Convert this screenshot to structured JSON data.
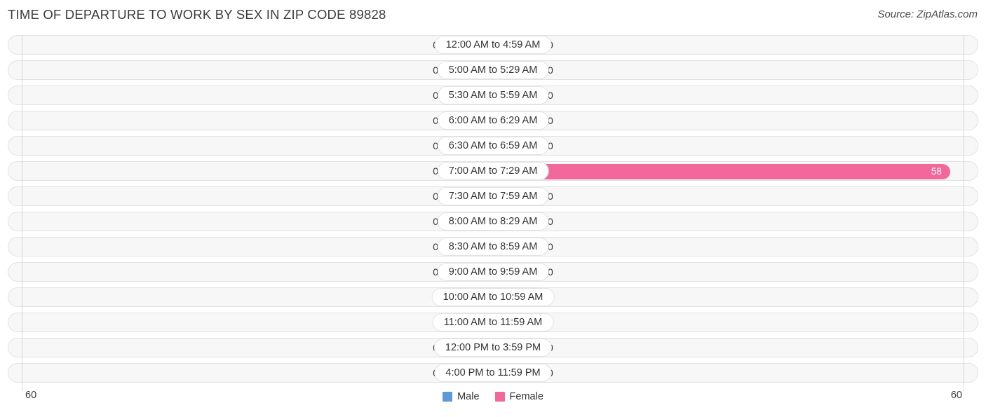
{
  "header": {
    "title": "TIME OF DEPARTURE TO WORK BY SEX IN ZIP CODE 89828",
    "source": "Source: ZipAtlas.com"
  },
  "axis": {
    "left_label": "60",
    "right_label": "60"
  },
  "legend": {
    "items": [
      {
        "label": "Male",
        "color": "#5b9bd5"
      },
      {
        "label": "Female",
        "color": "#f2689a"
      }
    ]
  },
  "colors": {
    "male_bar": "#a5c8ea",
    "female_bar": "#f7a8c4",
    "female_bar_highlight": "#f2689a",
    "row_background": "#f7f7f7",
    "row_border": "#e2e2e2",
    "gridline": "#d6d6d6",
    "title_text": "#3c3c3c"
  },
  "chart_data": {
    "type": "bar",
    "title": "TIME OF DEPARTURE TO WORK BY SEX IN ZIP CODE 89828",
    "subtitle": "Source: ZipAtlas.com",
    "orientation": "horizontal-diverging",
    "xlabel": "",
    "ylabel": "",
    "xlim": [
      60,
      0,
      60
    ],
    "axis_max": 60,
    "grid": true,
    "legend_position": "bottom-center",
    "categories": [
      "12:00 AM to 4:59 AM",
      "5:00 AM to 5:29 AM",
      "5:30 AM to 5:59 AM",
      "6:00 AM to 6:29 AM",
      "6:30 AM to 6:59 AM",
      "7:00 AM to 7:29 AM",
      "7:30 AM to 7:59 AM",
      "8:00 AM to 8:29 AM",
      "8:30 AM to 8:59 AM",
      "9:00 AM to 9:59 AM",
      "10:00 AM to 10:59 AM",
      "11:00 AM to 11:59 AM",
      "12:00 PM to 3:59 PM",
      "4:00 PM to 11:59 PM"
    ],
    "series": [
      {
        "name": "Male",
        "color": "#5b9bd5",
        "values": [
          0,
          0,
          0,
          0,
          0,
          0,
          0,
          0,
          0,
          0,
          0,
          0,
          0,
          0
        ]
      },
      {
        "name": "Female",
        "color": "#f2689a",
        "values": [
          0,
          0,
          0,
          0,
          0,
          58,
          0,
          0,
          0,
          0,
          0,
          0,
          0,
          0
        ]
      }
    ]
  },
  "rows": [
    {
      "label": "12:00 AM to 4:59 AM",
      "male": "0",
      "female": "0",
      "male_value": 0,
      "female_value": 0
    },
    {
      "label": "5:00 AM to 5:29 AM",
      "male": "0",
      "female": "0",
      "male_value": 0,
      "female_value": 0
    },
    {
      "label": "5:30 AM to 5:59 AM",
      "male": "0",
      "female": "0",
      "male_value": 0,
      "female_value": 0
    },
    {
      "label": "6:00 AM to 6:29 AM",
      "male": "0",
      "female": "0",
      "male_value": 0,
      "female_value": 0
    },
    {
      "label": "6:30 AM to 6:59 AM",
      "male": "0",
      "female": "0",
      "male_value": 0,
      "female_value": 0
    },
    {
      "label": "7:00 AM to 7:29 AM",
      "male": "0",
      "female": "58",
      "male_value": 0,
      "female_value": 58
    },
    {
      "label": "7:30 AM to 7:59 AM",
      "male": "0",
      "female": "0",
      "male_value": 0,
      "female_value": 0
    },
    {
      "label": "8:00 AM to 8:29 AM",
      "male": "0",
      "female": "0",
      "male_value": 0,
      "female_value": 0
    },
    {
      "label": "8:30 AM to 8:59 AM",
      "male": "0",
      "female": "0",
      "male_value": 0,
      "female_value": 0
    },
    {
      "label": "9:00 AM to 9:59 AM",
      "male": "0",
      "female": "0",
      "male_value": 0,
      "female_value": 0
    },
    {
      "label": "10:00 AM to 10:59 AM",
      "male": "0",
      "female": "0",
      "male_value": 0,
      "female_value": 0
    },
    {
      "label": "11:00 AM to 11:59 AM",
      "male": "0",
      "female": "0",
      "male_value": 0,
      "female_value": 0
    },
    {
      "label": "12:00 PM to 3:59 PM",
      "male": "0",
      "female": "0",
      "male_value": 0,
      "female_value": 0
    },
    {
      "label": "4:00 PM to 11:59 PM",
      "male": "0",
      "female": "0",
      "male_value": 0,
      "female_value": 0
    }
  ]
}
